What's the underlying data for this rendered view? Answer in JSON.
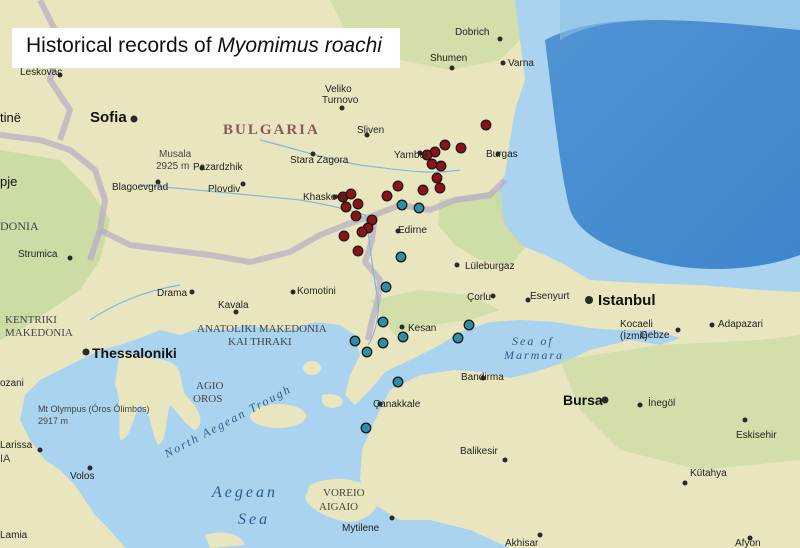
{
  "title": {
    "prefix": "Historical records of",
    "species": "Myomimus roachi"
  },
  "colors": {
    "sea": "#a9d3ee",
    "sea_deep": "#5e9fd8",
    "land": "#e9e6bf",
    "land_green": "#c8dca2",
    "border": "#b6a9c6",
    "red_marker": "#8e1212",
    "blue_marker": "#2d8fa6",
    "marker_stroke": "#1a1a1a"
  },
  "labels": {
    "country_bulgaria": "BULGARIA",
    "region_kentriki": "KENTRIKI",
    "region_makedonia": "MAKEDONIA",
    "region_anatoliki": "ANATOLIKI MAKEDONIA",
    "region_kai_thraki": "KAI THRAKI",
    "region_agio": "AGIO",
    "region_oros": "OROS",
    "region_voreio": "VOREIO",
    "region_aigaio": "AIGAIO",
    "partial_donia": "DONIA",
    "partial_pje": "pje",
    "partial_tine": "tinë",
    "partial_ia": "IA",
    "partial_ozani": "ozani",
    "sea_aegean": "Aegean",
    "sea_aegean_2": "Sea",
    "sea_marmara": "Sea of",
    "sea_marmara_2": "Marmara",
    "trough": "North Aegean Trough",
    "mountain_musala": "Musala",
    "mountain_musala_elev": "2925 m",
    "mountain_olympus": "Mt Olympus (Óros Ólimbos)",
    "mountain_olympus_elev": "2917 m",
    "city_sofia": "Sofia",
    "city_istanbul": "Istanbul",
    "city_thessaloniki": "Thessaloniki",
    "city_bursa": "Bursa",
    "city_dobrich": "Dobrich",
    "city_varna": "Varna",
    "city_shumen": "Shumen",
    "city_veliko": "Veliko",
    "city_turnovo": "Turnovo",
    "city_sliven": "Sliven",
    "city_yambol": "Yambol",
    "city_burgas": "Burgas",
    "city_stara_zagora": "Stara Zagora",
    "city_pazardzhik": "Pazardzhik",
    "city_plovdiv": "Plovdiv",
    "city_blagoevgrad": "Blagoevgrad",
    "city_khaskovo": "Khaskovo",
    "city_edirne": "Edirne",
    "city_luleburgaz": "Lüleburgaz",
    "city_corlu": "Çorlu",
    "city_esenyurt": "Esenyurt",
    "city_kocaeli": "Kocaeli",
    "city_izmit": "(İzmit)",
    "city_gebze": "Gebze",
    "city_adapazari": "Adapazari",
    "city_keşan": "Kesan",
    "city_komotini": "Komotini",
    "city_kavala": "Kavala",
    "city_drama": "Drama",
    "city_strumica": "Strumica",
    "city_leskovac": "Leskovac",
    "city_bandirma": "Bandirma",
    "city_canakkale": "Çanakkale",
    "city_balikesir": "Balikesir",
    "city_inegol": "İnegöl",
    "city_eskisehir": "Eskisehir",
    "city_kutahya": "Kütahya",
    "city_afyon": "Afyon",
    "city_akhisar": "Akhisar",
    "city_mytilene": "Mytilene",
    "city_volos": "Volos",
    "city_larissa": "Larissa",
    "city_lamia": "Lamia"
  }
}
